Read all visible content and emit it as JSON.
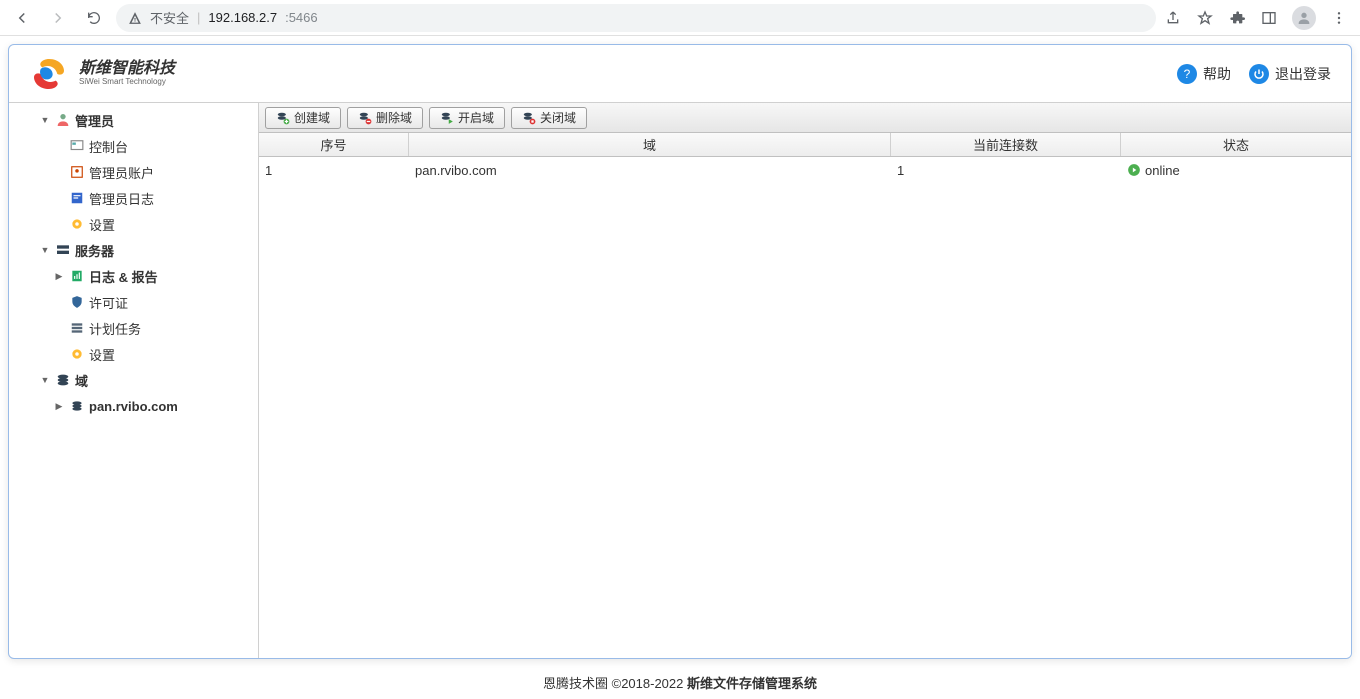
{
  "browser": {
    "insecure_label": "不安全",
    "host": "192.168.2.7",
    "port": ":5466"
  },
  "brand": {
    "title": "斯维智能科技",
    "subtitle": "SiWei Smart Technology"
  },
  "header": {
    "help": "帮助",
    "logout": "退出登录"
  },
  "sidebar": {
    "admin": {
      "label": "管理员",
      "console": "控制台",
      "account": "管理员账户",
      "log": "管理员日志",
      "settings": "设置"
    },
    "server": {
      "label": "服务器",
      "logs_reports": "日志 & 报告",
      "license": "许可证",
      "tasks": "计划任务",
      "settings": "设置"
    },
    "domain": {
      "label": "域",
      "item": "pan.rvibo.com"
    }
  },
  "toolbar": {
    "create": "创建域",
    "delete": "删除域",
    "open": "开启域",
    "close": "关闭域"
  },
  "table": {
    "headers": {
      "seq": "序号",
      "domain": "域",
      "connections": "当前连接数",
      "status": "状态"
    },
    "rows": [
      {
        "seq": "1",
        "domain": "pan.rvibo.com",
        "connections": "1",
        "status": "online"
      }
    ]
  },
  "footer": {
    "left": "恩腾技术圈 ©2018-2022 ",
    "right": "斯维文件存储管理系统"
  }
}
